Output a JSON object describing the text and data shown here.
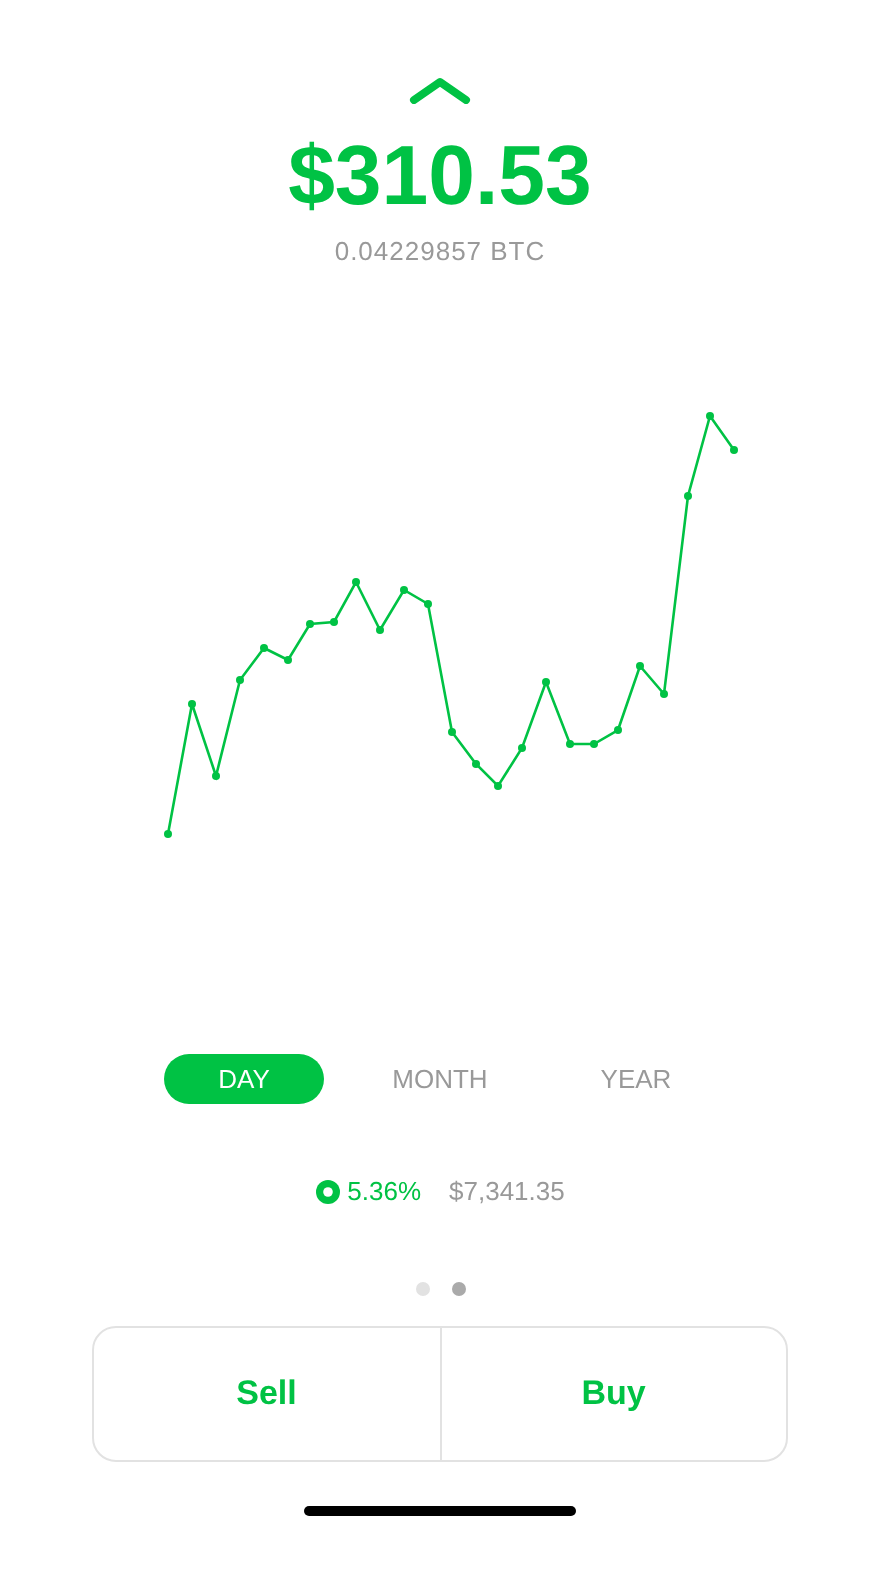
{
  "balance": {
    "amount": "$310.53",
    "btc": "0.04229857 BTC"
  },
  "ranges": [
    {
      "label": "DAY",
      "selected": true
    },
    {
      "label": "MONTH",
      "selected": false
    },
    {
      "label": "YEAR",
      "selected": false
    }
  ],
  "stats": {
    "change": "5.36%",
    "price": "$7,341.35"
  },
  "pages": [
    {
      "selected": false
    },
    {
      "selected": true
    }
  ],
  "actions": [
    {
      "label": "Sell"
    },
    {
      "label": "Buy"
    }
  ]
}
